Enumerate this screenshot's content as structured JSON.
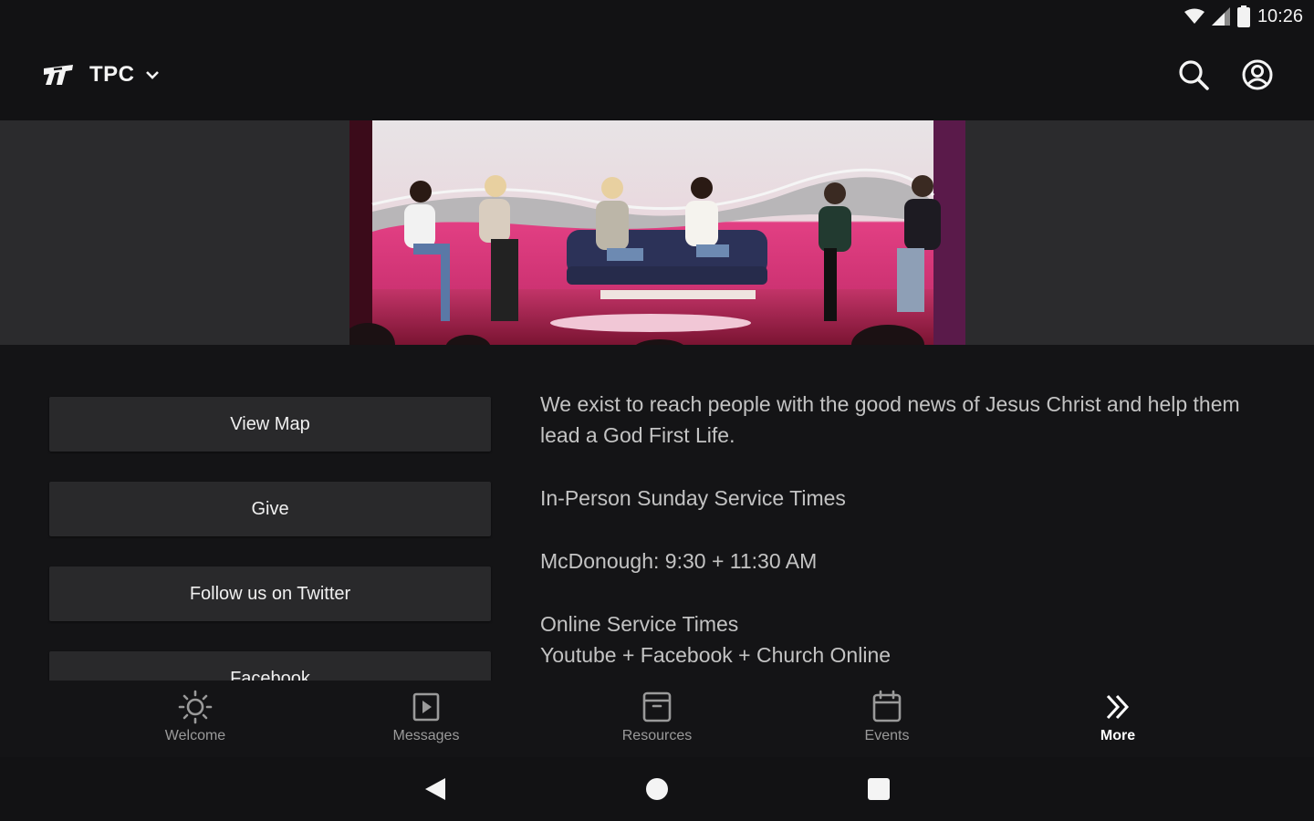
{
  "status_bar": {
    "time": "10:26",
    "icons": [
      "wifi-icon",
      "signal-icon",
      "battery-icon"
    ]
  },
  "app_bar": {
    "brand_name": "TPC",
    "icons": [
      "tpc-logo-icon",
      "chevron-down-icon",
      "search-icon",
      "account-icon"
    ]
  },
  "hero": {
    "image_description": "Panel of women seated on stage"
  },
  "buttons": [
    {
      "label": "View Map"
    },
    {
      "label": "Give"
    },
    {
      "label": "Follow us on Twitter"
    },
    {
      "label": "Facebook"
    }
  ],
  "about": {
    "mission": "We exist to reach people with the good news of Jesus Christ and help them lead a God First Life.",
    "service_heading": "In-Person Sunday Service Times",
    "service_times": "McDonough: 9:30 + 11:30 AM",
    "online_heading": "Online Service Times",
    "online_platforms": "Youtube + Facebook + Church Online"
  },
  "bottom_nav": [
    {
      "label": "Welcome",
      "icon": "sun-icon"
    },
    {
      "label": "Messages",
      "icon": "play-square-icon"
    },
    {
      "label": "Resources",
      "icon": "archive-icon"
    },
    {
      "label": "Events",
      "icon": "calendar-icon"
    },
    {
      "label": "More",
      "icon": "double-chevron-right-icon",
      "active": true
    }
  ],
  "system_nav": [
    "back-icon",
    "home-icon",
    "recents-icon"
  ],
  "colors": {
    "background": "#141416",
    "surface": "#29292b",
    "hero_band": "#2b2b2d",
    "text_muted": "#c3c3c3",
    "active": "#ffffff"
  }
}
